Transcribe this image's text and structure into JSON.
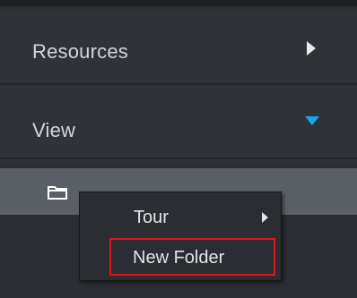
{
  "sidebar": {
    "sections": [
      {
        "label": "Resources",
        "expanded": false,
        "arrow_icon": "chevron-right-icon"
      },
      {
        "label": "View",
        "expanded": true,
        "arrow_icon": "chevron-down-icon",
        "arrow_color": "#19a6f0"
      }
    ],
    "selected_item": {
      "icon": "folder-icon"
    }
  },
  "context_menu": {
    "items": [
      {
        "label": "Tour",
        "has_submenu": true
      },
      {
        "label": "New Folder",
        "highlighted": true,
        "highlight_color": "#e0171e"
      }
    ]
  }
}
